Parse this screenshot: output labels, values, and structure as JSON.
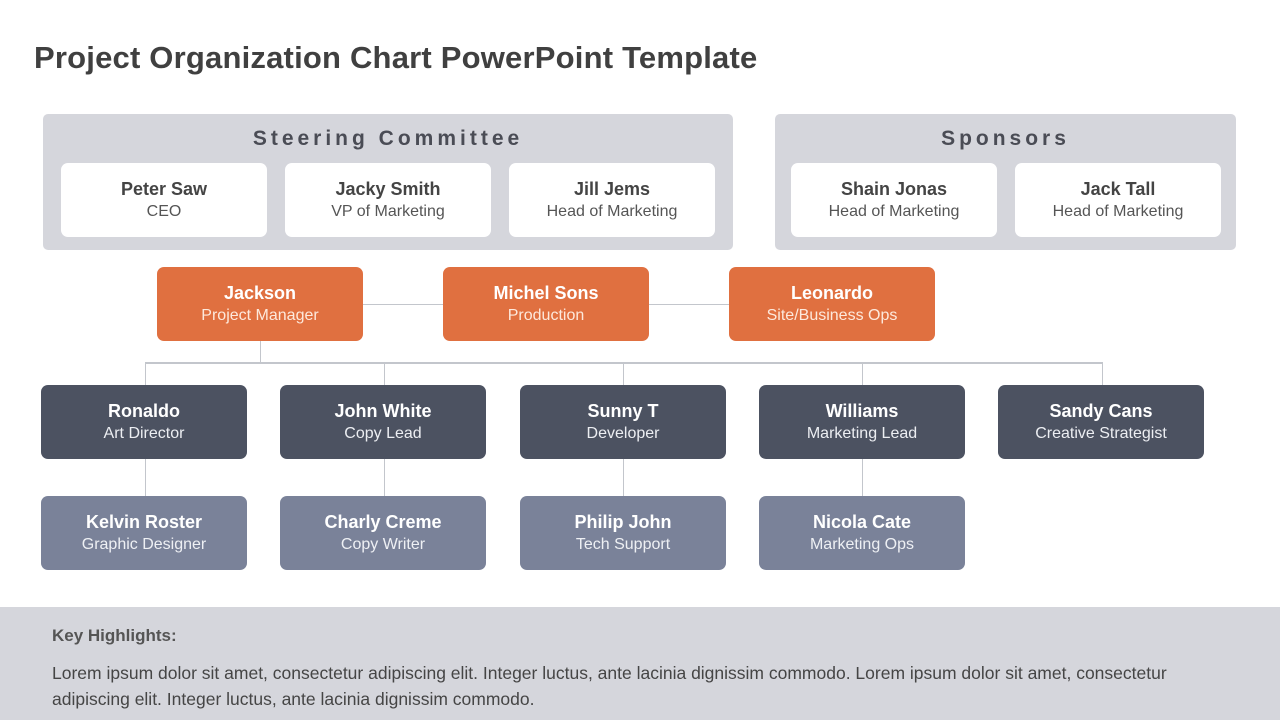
{
  "title": "Project Organization Chart PowerPoint Template",
  "colors": {
    "panel_bg": "#d5d6dc",
    "leadership": "#e07040",
    "team_lead": "#4c5261",
    "team_member": "#7a8299",
    "connector": "#c3c6cc"
  },
  "steering_committee": {
    "heading": "Steering Committee",
    "members": [
      {
        "name": "Peter Saw",
        "role": "CEO"
      },
      {
        "name": "Jacky Smith",
        "role": "VP of Marketing"
      },
      {
        "name": "Jill Jems",
        "role": "Head of Marketing"
      }
    ]
  },
  "sponsors": {
    "heading": "Sponsors",
    "members": [
      {
        "name": "Shain Jonas",
        "role": "Head of Marketing"
      },
      {
        "name": "Jack Tall",
        "role": "Head of Marketing"
      }
    ]
  },
  "leadership": [
    {
      "name": "Jackson",
      "role": "Project Manager"
    },
    {
      "name": "Michel Sons",
      "role": "Production"
    },
    {
      "name": "Leonardo",
      "role": "Site/Business Ops"
    }
  ],
  "team_leads": [
    {
      "name": "Ronaldo",
      "role": "Art Director"
    },
    {
      "name": "John White",
      "role": "Copy Lead"
    },
    {
      "name": "Sunny T",
      "role": "Developer"
    },
    {
      "name": "Williams",
      "role": "Marketing Lead"
    },
    {
      "name": "Sandy Cans",
      "role": "Creative Strategist"
    }
  ],
  "team_members": [
    {
      "name": "Kelvin Roster",
      "role": "Graphic Designer",
      "reports_to": "Ronaldo"
    },
    {
      "name": "Charly Creme",
      "role": "Copy Writer",
      "reports_to": "John White"
    },
    {
      "name": "Philip John",
      "role": "Tech Support",
      "reports_to": "Sunny T"
    },
    {
      "name": "Nicola Cate",
      "role": "Marketing Ops",
      "reports_to": "Williams"
    }
  ],
  "footer": {
    "heading": "Key Highlights:",
    "text": "Lorem ipsum dolor sit amet, consectetur  adipiscing elit. Integer luctus, ante lacinia dignissim commodo. Lorem ipsum dolor sit amet, consectetur adipiscing elit. Integer luctus, ante lacinia dignissim commodo."
  }
}
